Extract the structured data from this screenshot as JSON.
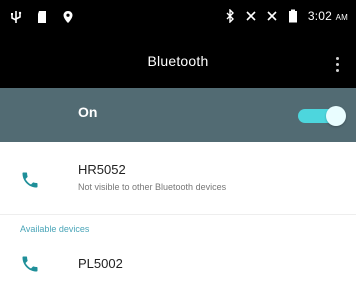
{
  "status_bar": {
    "time": "3:02",
    "time_suffix": "AM",
    "icons": [
      "usb-icon",
      "sd-card-icon",
      "location-icon",
      "bluetooth-icon",
      "vibrate-icon",
      "no-signal-icon",
      "battery-icon"
    ]
  },
  "app_bar": {
    "title": "Bluetooth",
    "menu_icon": "more-vert-icon"
  },
  "toggle": {
    "label": "On",
    "state": "on",
    "accent": "#4dd6dd",
    "background": "#526b73"
  },
  "this_device": {
    "name": "HR5052",
    "subtitle": "Not visible to other Bluetooth devices",
    "icon": "phone-icon"
  },
  "available": {
    "header": "Available devices",
    "devices": [
      {
        "name": "PL5002",
        "icon": "phone-icon"
      }
    ]
  },
  "colors": {
    "phone_icon": "#1f8f99",
    "section_header": "#4aa5b8"
  }
}
